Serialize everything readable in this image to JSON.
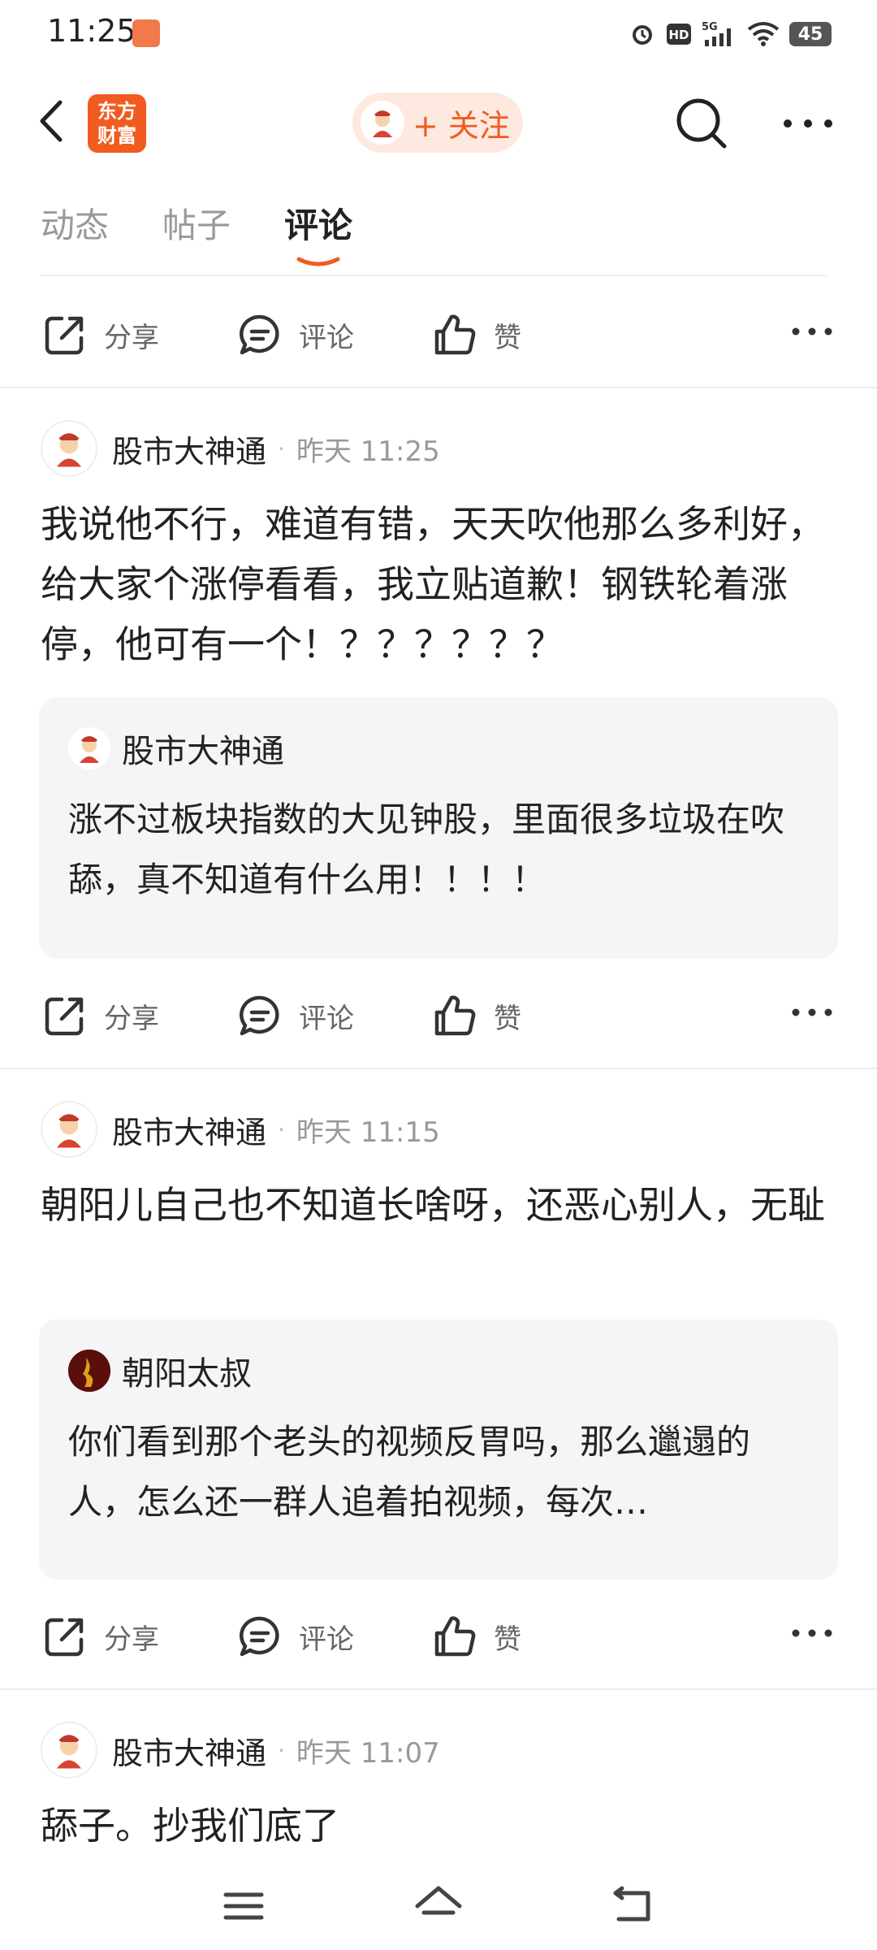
{
  "status_bar": {
    "time": "11:25",
    "app_icon": "taobao-icon",
    "icons": [
      "alarm-icon",
      "hd-icon",
      "5g-signal-icon",
      "wifi-icon"
    ],
    "battery": "45"
  },
  "header": {
    "back_icon": "back-arrow-icon",
    "logo_line1": "东方",
    "logo_line2": "财富",
    "follow_label": "+ 关注",
    "search_icon": "search-icon",
    "more_icon": "more-horizontal-icon"
  },
  "tabs": [
    {
      "label": "动态",
      "active": false
    },
    {
      "label": "帖子",
      "active": false
    },
    {
      "label": "评论",
      "active": true
    }
  ],
  "actions": {
    "share": "分享",
    "comment": "评论",
    "like": "赞"
  },
  "posts": [
    {
      "author": "股市大神通",
      "time": "昨天 11:25",
      "text": "我说他不行，难道有错，天天吹他那么多利好，给大家个涨停看看，我立贴道歉！钢铁轮着涨停，他可有一个！？？？？？？",
      "quote": {
        "author": "股市大神通",
        "text": "涨不过板块指数的大见钟股，里面很多垃圾在吹舔，真不知道有什么用！！！！"
      }
    },
    {
      "author": "股市大神通",
      "time": "昨天 11:15",
      "text": "朝阳儿自己也不知道长啥呀，还恶心别人，无耻",
      "quote": {
        "author": "朝阳太叔",
        "text": "你们看到那个老头的视频反胃吗，那么邋遢的人，怎么还一群人追着拍视频，每次…"
      }
    },
    {
      "author": "股市大神通",
      "time": "昨天 11:07",
      "text": "舔子。抄我们底了"
    }
  ],
  "nav": {
    "menu_icon": "menu-icon",
    "home_icon": "home-icon",
    "back_icon": "back-icon"
  },
  "colors": {
    "accent": "#f15b20",
    "follow_bg": "#fde9e0",
    "quote_bg": "#f5f5f8"
  }
}
